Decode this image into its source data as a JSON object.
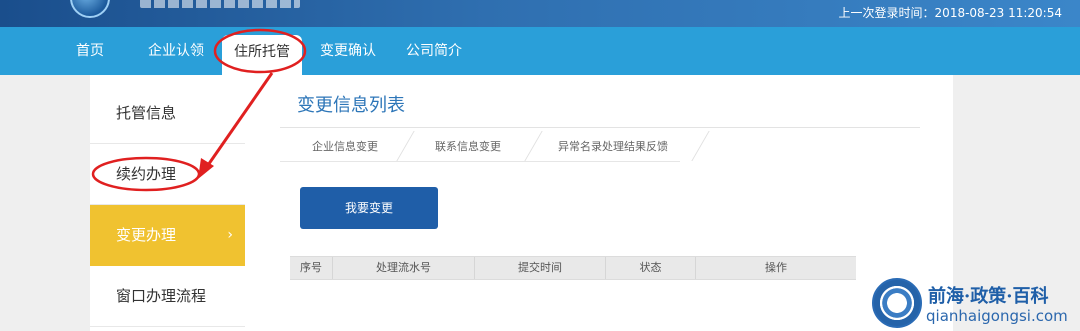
{
  "header": {
    "last_login": "上一次登录时间：2018-08-23 11:20:54"
  },
  "nav": {
    "items": [
      {
        "label": "首页"
      },
      {
        "label": "企业认领"
      },
      {
        "label": "住所托管"
      },
      {
        "label": "变更确认"
      },
      {
        "label": "公司简介"
      }
    ],
    "active_index": 2
  },
  "sidebar": {
    "items": [
      {
        "label": "托管信息"
      },
      {
        "label": "续约办理"
      },
      {
        "label": "变更办理",
        "chevron": "›"
      },
      {
        "label": "窗口办理流程"
      }
    ],
    "active_index": 2
  },
  "main": {
    "title": "变更信息列表",
    "subtabs": [
      {
        "label": "企业信息变更"
      },
      {
        "label": "联系信息变更"
      },
      {
        "label": "异常名录处理结果反馈"
      }
    ],
    "action_button": "我要变更",
    "table": {
      "columns": [
        "序号",
        "处理流水号",
        "提交时间",
        "状态",
        "操作"
      ]
    }
  },
  "watermark": {
    "title": "前海·政策·百科",
    "url": "qianhaigongsi.com"
  },
  "colors": {
    "nav_bg": "#2a9fd9",
    "sidebar_active": "#f0c230",
    "button_bg": "#1f5ea8",
    "title_color": "#2d76b8",
    "annotation_red": "#e02020"
  },
  "icons": {
    "sidebar_chevron": "chevron-right-icon"
  }
}
